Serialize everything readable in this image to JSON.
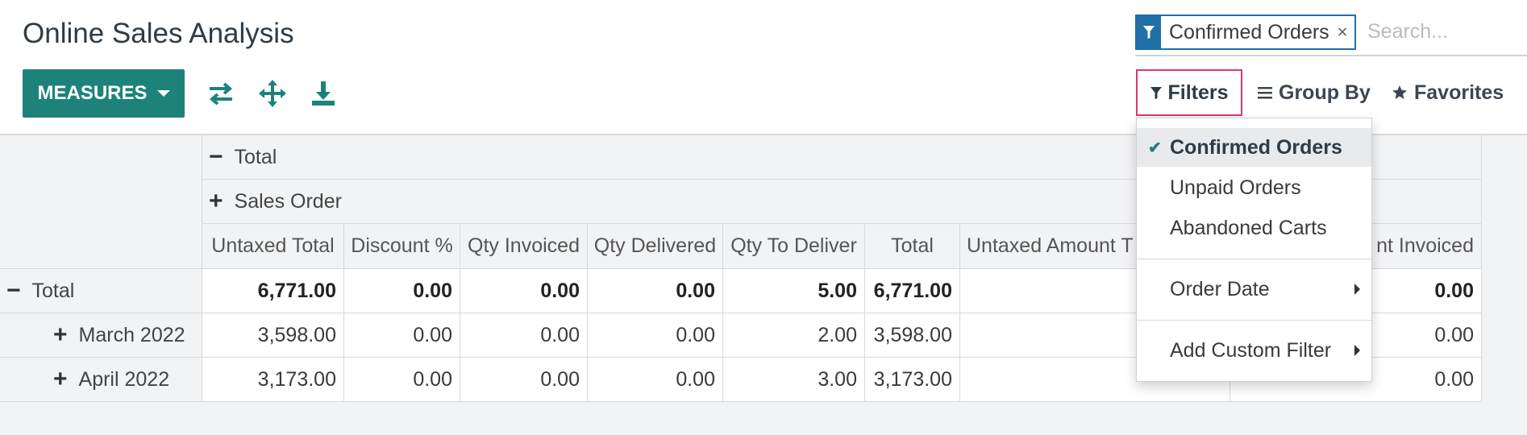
{
  "page": {
    "title": "Online Sales Analysis"
  },
  "toolbar": {
    "measures_label": "MEASURES",
    "flip_axis_icon": "flip-axis-icon",
    "expand_all_icon": "expand-all-icon",
    "download_icon": "download-icon"
  },
  "search": {
    "facet_label": "Confirmed Orders",
    "facet_icon": "filter-icon",
    "facet_remove": "×",
    "placeholder": "Search..."
  },
  "controls": {
    "filters_label": "Filters",
    "groupby_label": "Group By",
    "favorites_label": "Favorites"
  },
  "filters_menu": {
    "items": [
      {
        "label": "Confirmed Orders",
        "checked": true
      },
      {
        "label": "Unpaid Orders",
        "checked": false
      },
      {
        "label": "Abandoned Carts",
        "checked": false
      }
    ],
    "order_date": "Order Date",
    "custom_filter": "Add Custom Filter"
  },
  "pivot": {
    "col_total": "Total",
    "col_sales_order": "Sales Order",
    "measures": [
      "Untaxed Total",
      "Discount %",
      "Qty Invoiced",
      "Qty Delivered",
      "Qty To Deliver",
      "Total",
      "Untaxed Amount T",
      "nt Invoiced"
    ],
    "rows": [
      {
        "label": "Total",
        "expanded": true,
        "values": [
          "6,771.00",
          "0.00",
          "0.00",
          "0.00",
          "5.00",
          "6,771.00",
          "",
          "0.00"
        ]
      },
      {
        "label": "March 2022",
        "expanded": false,
        "values": [
          "3,598.00",
          "0.00",
          "0.00",
          "0.00",
          "2.00",
          "3,598.00",
          "",
          "0.00"
        ]
      },
      {
        "label": "April 2022",
        "expanded": false,
        "values": [
          "3,173.00",
          "0.00",
          "0.00",
          "0.00",
          "3.00",
          "3,173.00",
          "",
          "0.00"
        ]
      }
    ]
  },
  "colors": {
    "primary": "#1d837a",
    "facet": "#1f6fa8",
    "filters_border": "#d83b6a"
  }
}
